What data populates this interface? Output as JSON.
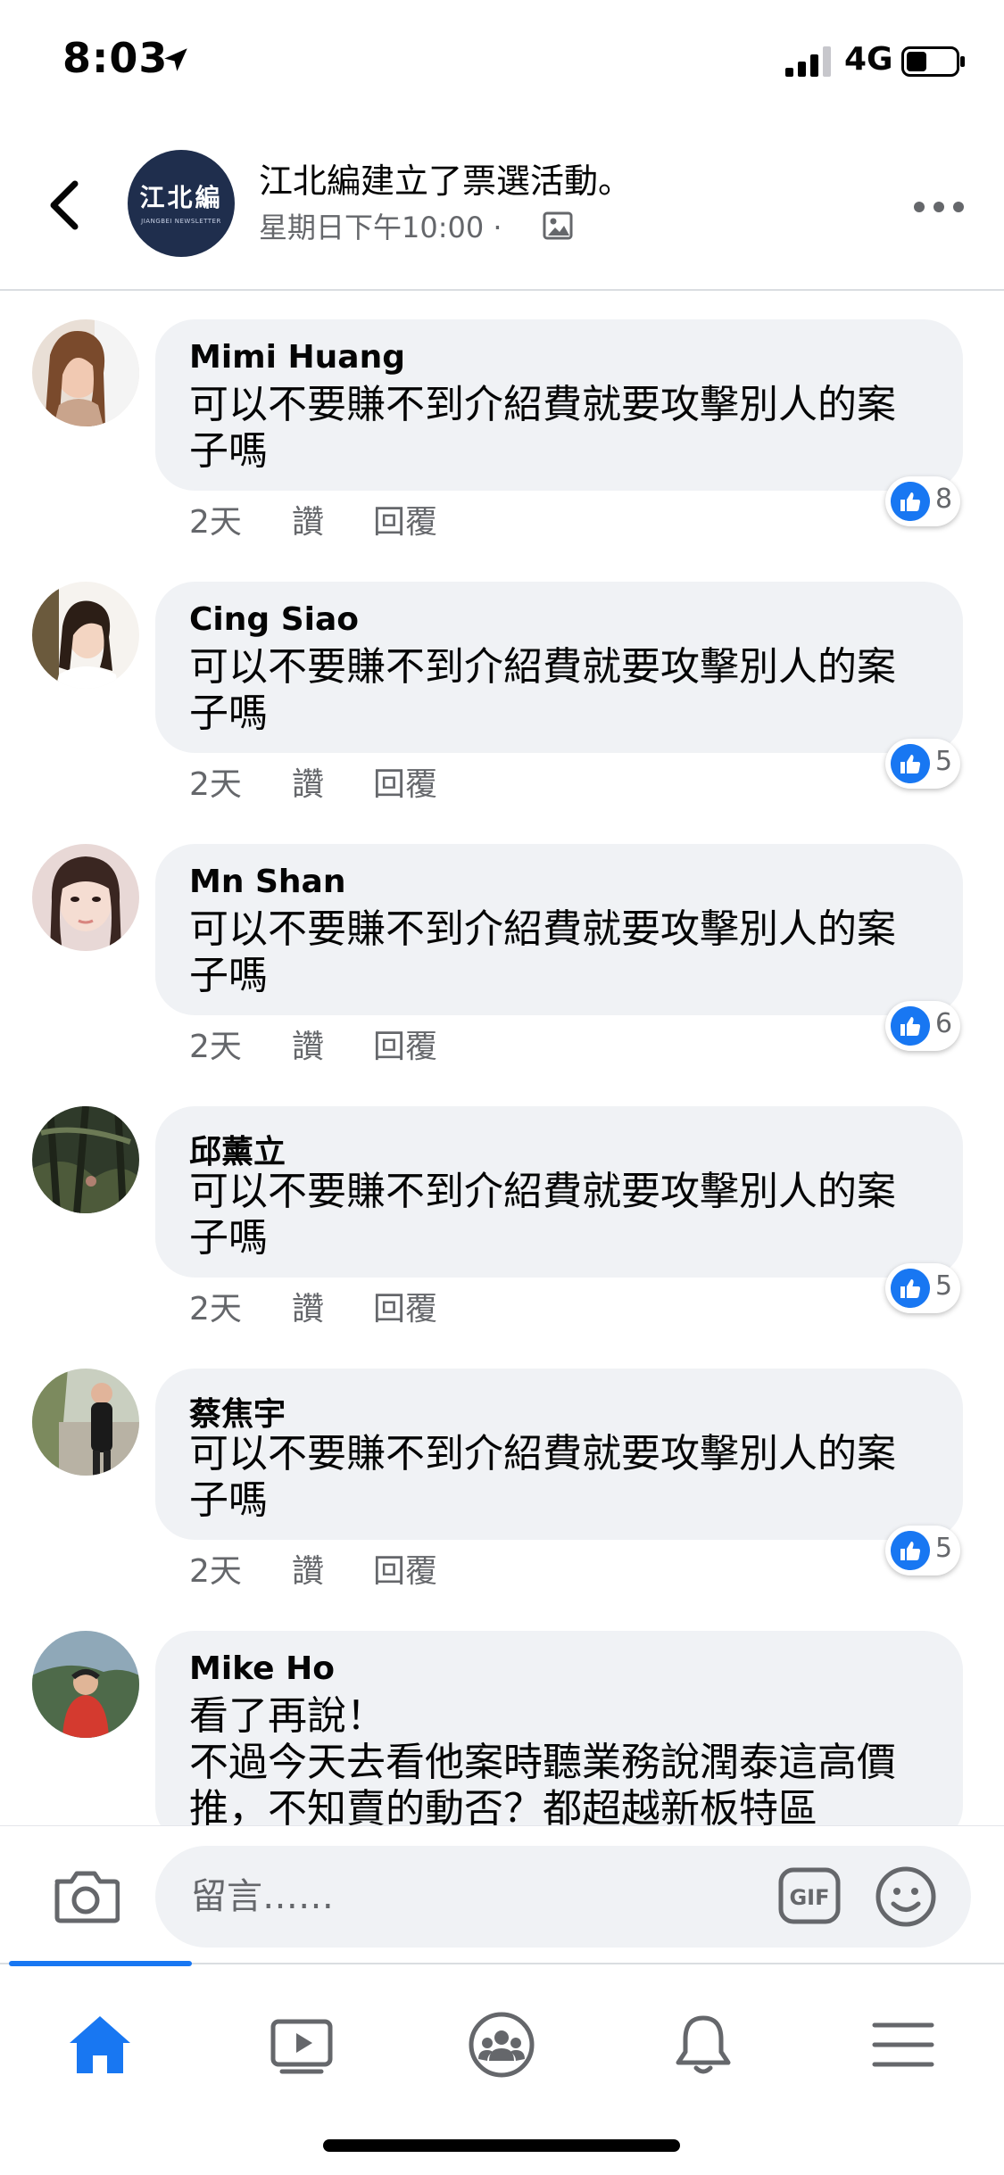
{
  "status_bar": {
    "time": "8:03",
    "network": "4G"
  },
  "header": {
    "page_logo_text": "江北編",
    "page_logo_sub": "JIANGBEI NEWSLETTER",
    "title": "江北編建立了票選活動。",
    "subtitle": "星期日下午10:00 ·"
  },
  "comments": [
    {
      "name": "Mimi Huang",
      "text": "可以不要賺不到介紹費就要攻擊別人的案子嗎",
      "time": "2天",
      "like": "讚",
      "reply": "回覆",
      "reactions": "8"
    },
    {
      "name": "Cing Siao",
      "text": "可以不要賺不到介紹費就要攻擊別人的案子嗎",
      "time": "2天",
      "like": "讚",
      "reply": "回覆",
      "reactions": "5"
    },
    {
      "name": "Mn Shan",
      "text": "可以不要賺不到介紹費就要攻擊別人的案子嗎",
      "time": "2天",
      "like": "讚",
      "reply": "回覆",
      "reactions": "6"
    },
    {
      "name": "邱薰立",
      "text": "可以不要賺不到介紹費就要攻擊別人的案子嗎",
      "time": "2天",
      "like": "讚",
      "reply": "回覆",
      "reactions": "5"
    },
    {
      "name": "蔡焦宇",
      "text": "可以不要賺不到介紹費就要攻擊別人的案子嗎",
      "time": "2天",
      "like": "讚",
      "reply": "回覆",
      "reactions": "5"
    },
    {
      "name": "Mike Ho",
      "text_line1": "看了再說！",
      "text_line2": "不過今天去看他案時聽業務說潤泰這高價推，不知賣的動否？都超越新板特區"
    }
  ],
  "composer": {
    "placeholder": "留言……"
  },
  "colors": {
    "accent": "#1877f2",
    "bubble": "#f0f2f5",
    "meta": "#65676b"
  },
  "icons": [
    "back-icon",
    "photo-icon",
    "more-icon",
    "camera-icon",
    "gif-icon",
    "emoji-icon",
    "home-icon",
    "watch-icon",
    "groups-icon",
    "bell-icon",
    "menu-icon",
    "like-icon"
  ]
}
